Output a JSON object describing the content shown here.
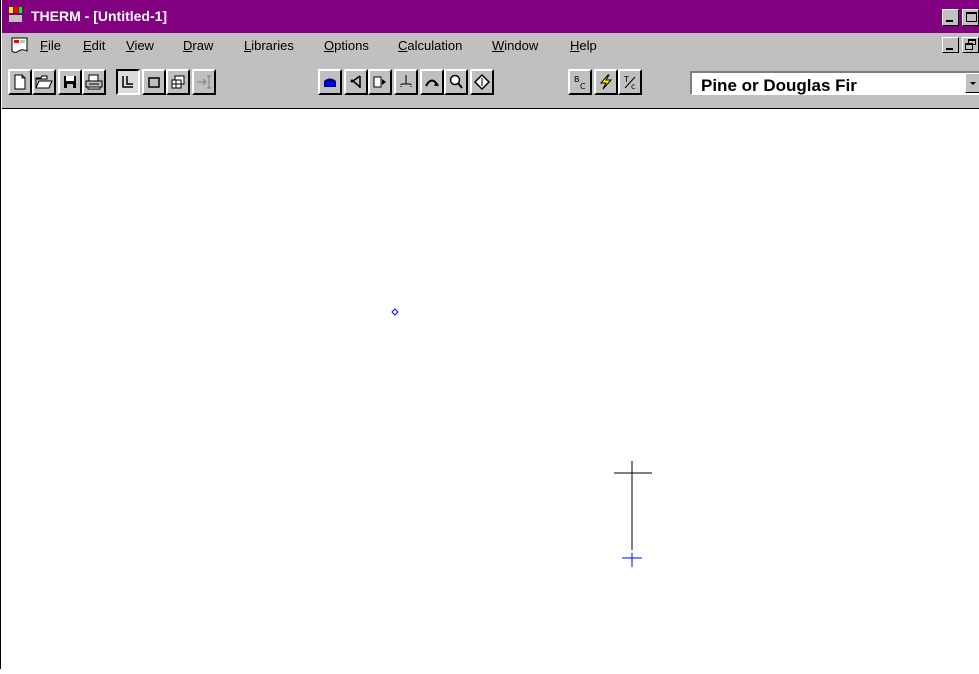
{
  "window": {
    "title": "THERM - [Untitled-1]"
  },
  "menu": {
    "items": [
      {
        "label": "File",
        "mnemonic": "F"
      },
      {
        "label": "Edit",
        "mnemonic": "E"
      },
      {
        "label": "View",
        "mnemonic": "V"
      },
      {
        "label": "Draw",
        "mnemonic": "D"
      },
      {
        "label": "Libraries",
        "mnemonic": "L"
      },
      {
        "label": "Options",
        "mnemonic": "O"
      },
      {
        "label": "Calculation",
        "mnemonic": "C"
      },
      {
        "label": "Window",
        "mnemonic": "W"
      },
      {
        "label": "Help",
        "mnemonic": "H"
      }
    ]
  },
  "toolbar": {
    "icons": [
      "new-file-icon",
      "open-file-icon",
      "save-icon",
      "print-icon",
      "polyline-icon",
      "rectangle-icon",
      "insert-window-icon",
      "locator-icon",
      "fill-void-icon",
      "select-point-icon",
      "boundary-icon",
      "rotate-icon",
      "arc-icon",
      "zoom-icon",
      "view-drag-icon",
      "boundary-conditions-icon",
      "calculate-icon",
      "tfactor-icon"
    ],
    "material_selected": "Pine or Douglas Fir",
    "boundary_glyph": {
      "top": "B",
      "bottom": "C"
    },
    "tfactor_glyph": {
      "top": "T",
      "bottom": "c"
    }
  },
  "colors": {
    "titlebar": "#800080",
    "chrome": "#c0c0c0",
    "accent_blue": "#0000ff"
  }
}
